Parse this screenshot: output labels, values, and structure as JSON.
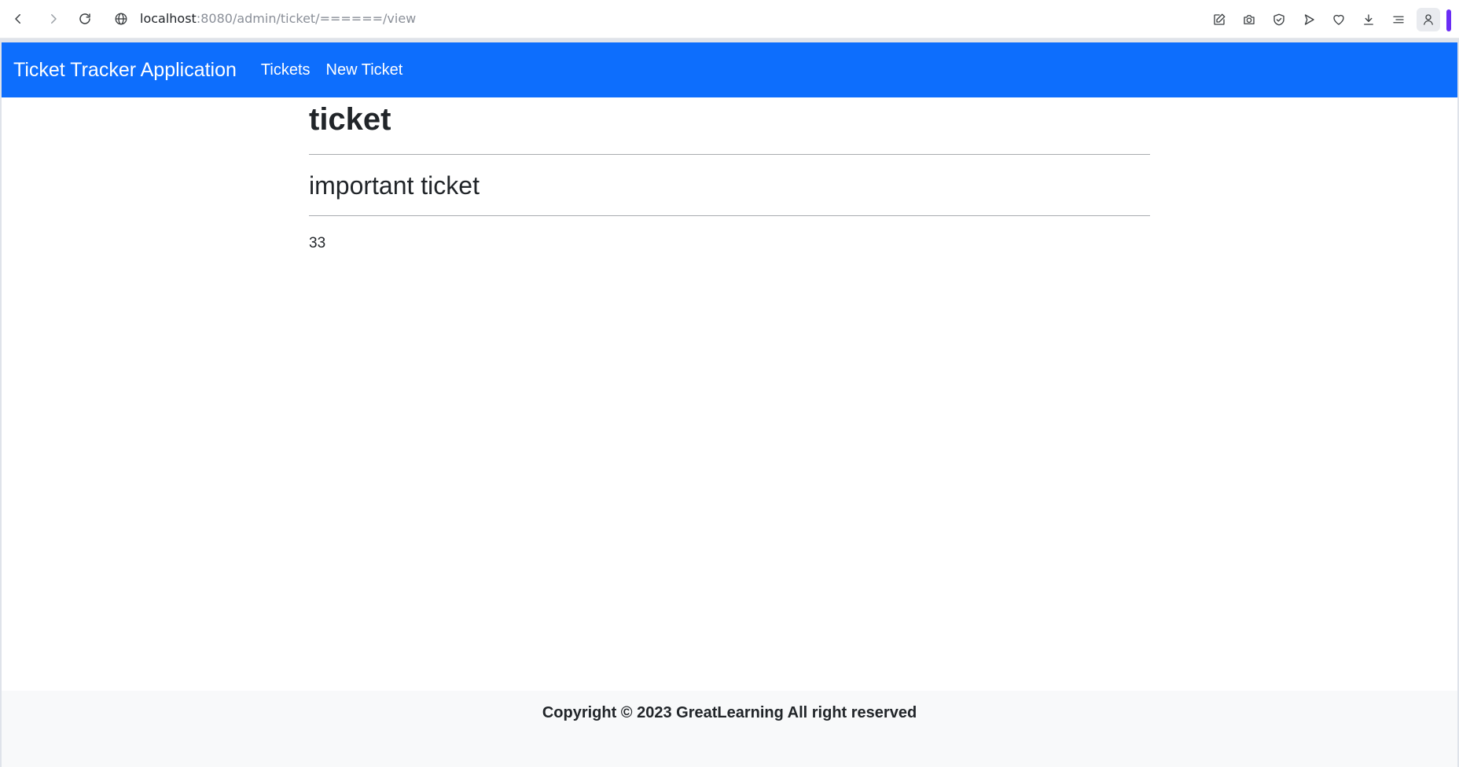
{
  "browser": {
    "url_host": "localhost",
    "url_rest": ":8080/admin/ticket/======/view"
  },
  "navbar": {
    "brand": "Ticket Tracker Application",
    "links": [
      "Tickets",
      "New Ticket"
    ],
    "color": "#0d6efd"
  },
  "ticket": {
    "title": "ticket",
    "short_description": "important ticket",
    "content": "33"
  },
  "footer": {
    "text": "Copyright © 2023 GreatLearning All right reserved"
  },
  "icons": [
    "back-icon",
    "forward-icon",
    "reload-icon",
    "globe-icon",
    "edit-icon",
    "camera-icon",
    "shield-check-icon",
    "send-icon",
    "heart-icon",
    "download-icon",
    "menu-icon",
    "profile-icon"
  ]
}
